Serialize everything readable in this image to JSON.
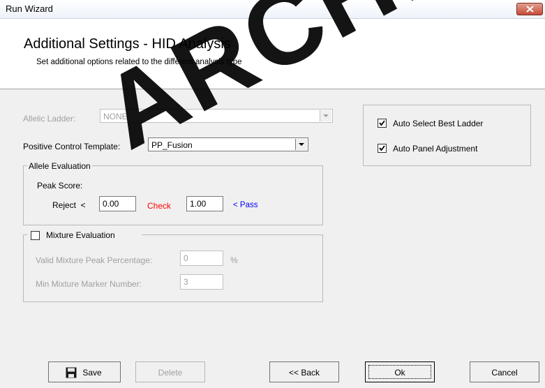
{
  "window": {
    "title": "Run Wizard"
  },
  "header": {
    "title": "Additional Settings - HID Analysis",
    "subtitle": "Set additional options related to the different analysis type"
  },
  "allelic_ladder": {
    "label": "Allelic Ladder:",
    "value": "NONE"
  },
  "positive_control": {
    "label": "Positive Control Template:",
    "value": "PP_Fusion"
  },
  "allele_evaluation": {
    "title": "Allele Evaluation",
    "peak_score_label": "Peak Score:",
    "reject_label": "Reject  <",
    "reject_value": "0.00",
    "check_label": "Check",
    "check_value": "1.00",
    "pass_label": "< Pass"
  },
  "mixture_evaluation": {
    "title": "Mixture Evaluation",
    "checked": false,
    "valid_peak_label": "Valid Mixture Peak Percentage:",
    "valid_peak_value": "0",
    "percent_sign": "%",
    "min_marker_label": "Min Mixture Marker Number:",
    "min_marker_value": "3"
  },
  "options": {
    "auto_select": {
      "label": "Auto Select Best Ladder",
      "checked": true
    },
    "auto_panel": {
      "label": "Auto Panel Adjustment",
      "checked": true
    }
  },
  "buttons": {
    "save": "Save",
    "delete": "Delete",
    "back": "<< Back",
    "ok": "Ok",
    "cancel": "Cancel"
  },
  "watermark": "ARCHIVED",
  "colors": {
    "check_red": "#ff0000",
    "pass_blue": "#0000ff",
    "disabled_gray": "#a0a0a0"
  }
}
